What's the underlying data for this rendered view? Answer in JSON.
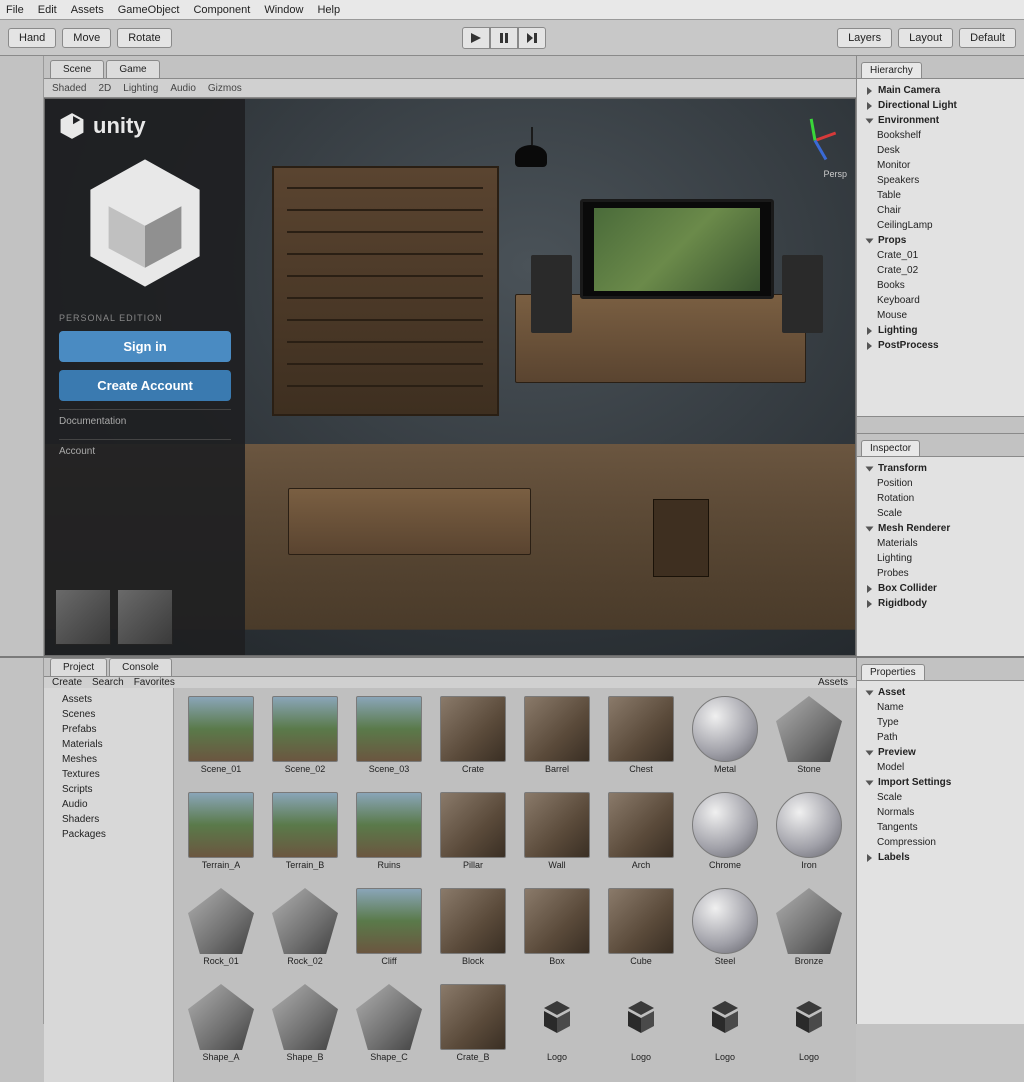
{
  "menubar": [
    "File",
    "Edit",
    "Assets",
    "GameObject",
    "Component",
    "Window",
    "Help"
  ],
  "toolbar": {
    "left": [
      "Hand",
      "Move",
      "Rotate"
    ],
    "center_play": "Play",
    "center_pause": "Pause",
    "center_step": "Step",
    "right": [
      "Layers",
      "Layout",
      "Default"
    ]
  },
  "scene": {
    "tabs": [
      "Scene",
      "Game"
    ],
    "toolbar_items": [
      "Shaded",
      "2D",
      "Lighting",
      "Audio",
      "Gizmos"
    ],
    "gizmo_label": "Persp"
  },
  "overlay": {
    "brand": "unity",
    "subtitle": "PERSONAL EDITION",
    "btn_primary": "Sign in",
    "btn_secondary": "Create Account",
    "link1": "Documentation",
    "link2": "Account"
  },
  "hierarchy": {
    "tab": "Hierarchy",
    "tab2": "Inspector",
    "items": [
      {
        "label": "Main Camera",
        "lvl": 1
      },
      {
        "label": "Directional Light",
        "lvl": 1
      },
      {
        "label": "Environment",
        "lvl": 1,
        "open": true
      },
      {
        "label": "Bookshelf",
        "lvl": 2
      },
      {
        "label": "Desk",
        "lvl": 2
      },
      {
        "label": "Monitor",
        "lvl": 2
      },
      {
        "label": "Speakers",
        "lvl": 2
      },
      {
        "label": "Table",
        "lvl": 2
      },
      {
        "label": "Chair",
        "lvl": 2
      },
      {
        "label": "CeilingLamp",
        "lvl": 2
      },
      {
        "label": "Props",
        "lvl": 1,
        "open": true
      },
      {
        "label": "Crate_01",
        "lvl": 2
      },
      {
        "label": "Crate_02",
        "lvl": 2
      },
      {
        "label": "Books",
        "lvl": 2
      },
      {
        "label": "Keyboard",
        "lvl": 2
      },
      {
        "label": "Mouse",
        "lvl": 2
      },
      {
        "label": "Lighting",
        "lvl": 1
      },
      {
        "label": "PostProcess",
        "lvl": 1
      }
    ]
  },
  "inspector": {
    "tab": "Inspector",
    "items": [
      {
        "label": "Transform",
        "lvl": 1,
        "open": true
      },
      {
        "label": "Position",
        "lvl": 2
      },
      {
        "label": "Rotation",
        "lvl": 2
      },
      {
        "label": "Scale",
        "lvl": 2
      },
      {
        "label": "Mesh Renderer",
        "lvl": 1,
        "open": true
      },
      {
        "label": "Materials",
        "lvl": 2
      },
      {
        "label": "Lighting",
        "lvl": 2
      },
      {
        "label": "Probes",
        "lvl": 2
      },
      {
        "label": "Box Collider",
        "lvl": 1
      },
      {
        "label": "Rigidbody",
        "lvl": 1
      }
    ]
  },
  "project": {
    "tabs": [
      "Project",
      "Console"
    ],
    "toolbar": [
      "Create",
      "Search",
      "Favorites"
    ],
    "breadcrumb": "Assets",
    "folders": [
      "Assets",
      "Scenes",
      "Prefabs",
      "Materials",
      "Meshes",
      "Textures",
      "Scripts",
      "Audio",
      "Shaders",
      "Packages"
    ],
    "assets": [
      {
        "label": "Scene_01",
        "type": "scene"
      },
      {
        "label": "Scene_02",
        "type": "scene"
      },
      {
        "label": "Scene_03",
        "type": "scene"
      },
      {
        "label": "Crate",
        "type": "prefab"
      },
      {
        "label": "Barrel",
        "type": "prefab"
      },
      {
        "label": "Chest",
        "type": "prefab"
      },
      {
        "label": "Metal",
        "type": "material"
      },
      {
        "label": "Stone",
        "type": "mesh"
      },
      {
        "label": "Terrain_A",
        "type": "scene"
      },
      {
        "label": "Terrain_B",
        "type": "scene"
      },
      {
        "label": "Ruins",
        "type": "scene"
      },
      {
        "label": "Pillar",
        "type": "prefab"
      },
      {
        "label": "Wall",
        "type": "prefab"
      },
      {
        "label": "Arch",
        "type": "prefab"
      },
      {
        "label": "Chrome",
        "type": "material"
      },
      {
        "label": "Iron",
        "type": "material"
      },
      {
        "label": "Rock_01",
        "type": "mesh"
      },
      {
        "label": "Rock_02",
        "type": "mesh"
      },
      {
        "label": "Cliff",
        "type": "scene"
      },
      {
        "label": "Block",
        "type": "prefab"
      },
      {
        "label": "Box",
        "type": "prefab"
      },
      {
        "label": "Cube",
        "type": "prefab"
      },
      {
        "label": "Steel",
        "type": "material"
      },
      {
        "label": "Bronze",
        "type": "mesh"
      },
      {
        "label": "Shape_A",
        "type": "mesh"
      },
      {
        "label": "Shape_B",
        "type": "mesh"
      },
      {
        "label": "Shape_C",
        "type": "mesh"
      },
      {
        "label": "Crate_B",
        "type": "prefab"
      },
      {
        "label": "Logo",
        "type": "unity-logo"
      },
      {
        "label": "Logo",
        "type": "unity-logo"
      },
      {
        "label": "Logo",
        "type": "unity-logo"
      },
      {
        "label": "Logo",
        "type": "unity-logo"
      }
    ]
  },
  "right_bottom": {
    "tab": "Properties",
    "items": [
      {
        "label": "Asset",
        "lvl": 1,
        "open": true
      },
      {
        "label": "Name",
        "lvl": 2
      },
      {
        "label": "Type",
        "lvl": 2
      },
      {
        "label": "Path",
        "lvl": 2
      },
      {
        "label": "Preview",
        "lvl": 1,
        "open": true
      },
      {
        "label": "Model",
        "lvl": 2
      },
      {
        "label": "Import Settings",
        "lvl": 1,
        "open": true
      },
      {
        "label": "Scale",
        "lvl": 2
      },
      {
        "label": "Normals",
        "lvl": 2
      },
      {
        "label": "Tangents",
        "lvl": 2
      },
      {
        "label": "Compression",
        "lvl": 2
      },
      {
        "label": "Labels",
        "lvl": 1
      }
    ]
  }
}
